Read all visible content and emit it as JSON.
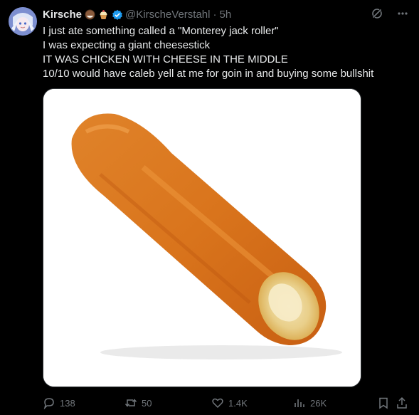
{
  "author": {
    "name": "Kirsche",
    "emojis": [
      "coconut-emoji",
      "cupcake-emoji"
    ],
    "verified": true,
    "handle": "@KirscheVerstahl",
    "separator": "·",
    "time": "5h"
  },
  "tweet": {
    "lines": [
      "I just ate something called a \"Monterey jack roller\"",
      "I was expecting a giant cheesestick",
      "IT WAS CHICKEN WITH CHEESE IN THE MIDDLE",
      "10/10 would have caleb yell at me for goin in and buying some bullshit"
    ]
  },
  "media": {
    "subject": "monterey-jack-roller-photo"
  },
  "actions": {
    "replies": "138",
    "reposts": "50",
    "likes": "1.4K",
    "views": "26K"
  },
  "colors": {
    "background": "#000000",
    "text": "#e7e9ea",
    "muted": "#71767b",
    "verified": "#1d9bf0"
  }
}
